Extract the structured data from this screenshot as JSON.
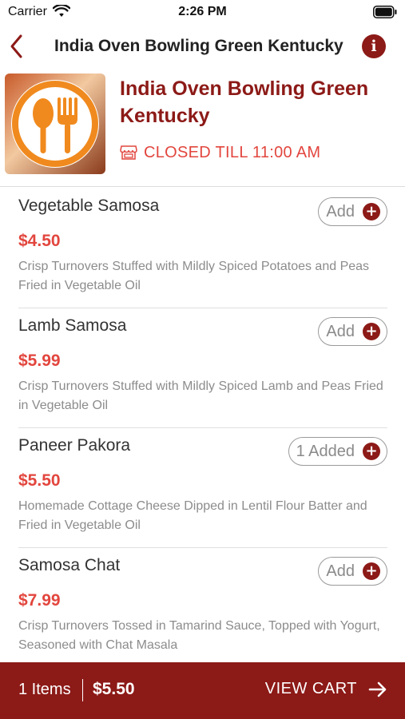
{
  "status_bar": {
    "carrier": "Carrier",
    "time": "2:26 PM"
  },
  "nav": {
    "title": "India Oven Bowling Green Kentucky",
    "info_glyph": "i"
  },
  "restaurant": {
    "name": "India Oven Bowling Green Kentucky",
    "status": "CLOSED TILL 11:00 AM",
    "logo_icon": "spoon-fork-icon",
    "brand_color": "#8c1a17",
    "accent_color": "#e2463e"
  },
  "items": [
    {
      "name": "Vegetable Samosa",
      "price": "$4.50",
      "description": "Crisp Turnovers Stuffed with Mildly Spiced Potatoes and Peas Fried in Vegetable Oil",
      "button": "Add"
    },
    {
      "name": "Lamb Samosa",
      "price": "$5.99",
      "description": "Crisp Turnovers Stuffed with Mildly Spiced Lamb and Peas Fried in Vegetable Oil",
      "button": "Add"
    },
    {
      "name": "Paneer Pakora",
      "price": "$5.50",
      "description": "Homemade Cottage Cheese Dipped in Lentil Flour Batter and Fried in Vegetable Oil",
      "button": "1 Added"
    },
    {
      "name": "Samosa Chat",
      "price": "$7.99",
      "description": "Crisp Turnovers Tossed in Tamarind Sauce, Topped with Yogurt, Seasoned with Chat Masala",
      "button": "Add"
    }
  ],
  "cart": {
    "count": "1 Items",
    "total": "$5.50",
    "action": "VIEW CART"
  }
}
